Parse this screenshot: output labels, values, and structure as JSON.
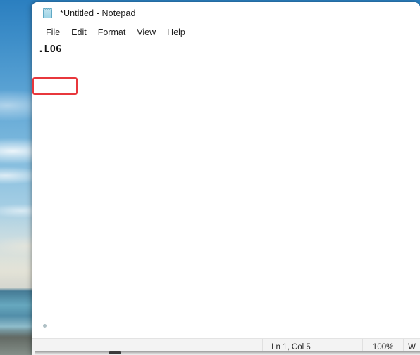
{
  "window": {
    "title": "*Untitled - Notepad",
    "icon": "notepad-icon"
  },
  "menubar": {
    "items": [
      {
        "label": "File"
      },
      {
        "label": "Edit"
      },
      {
        "label": "Format"
      },
      {
        "label": "View"
      },
      {
        "label": "Help"
      }
    ]
  },
  "editor": {
    "content": ".LOG",
    "highlight_color": "#e8373c"
  },
  "statusbar": {
    "position": "Ln 1, Col 5",
    "zoom": "100%",
    "encoding": "W"
  }
}
